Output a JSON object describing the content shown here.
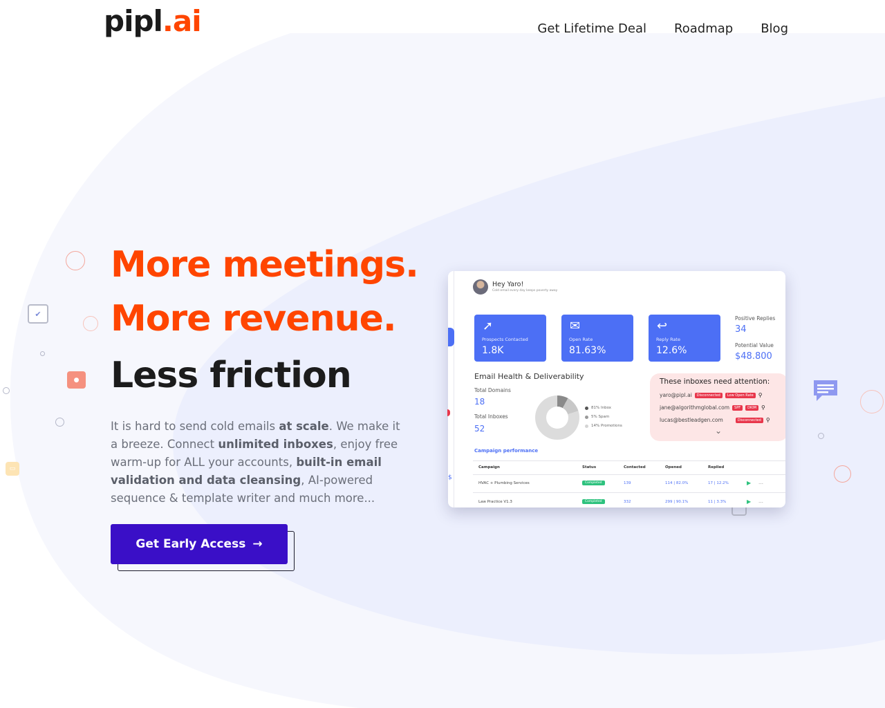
{
  "brand": {
    "logo_main": "pipl",
    "logo_accent": ".ai"
  },
  "nav": {
    "items": [
      "Get Lifetime Deal",
      "Roadmap",
      "Blog"
    ]
  },
  "hero": {
    "line1": "More meetings.",
    "line2": "More revenue.",
    "line3": "Less friction",
    "desc": [
      {
        "t": "It is hard to send cold emails ",
        "b": false
      },
      {
        "t": "at scale",
        "b": true
      },
      {
        "t": ". We make it a breeze. Connect ",
        "b": false
      },
      {
        "t": "unlimited inboxes",
        "b": true
      },
      {
        "t": ", enjoy free warm-up for ALL your accounts, ",
        "b": false
      },
      {
        "t": "built-in email validation and data cleansing",
        "b": true
      },
      {
        "t": ", AI-powered sequence & template writer and much more...",
        "b": false
      }
    ],
    "cta_label": "Get Early Access",
    "cta_arrow": "→"
  },
  "dashboard": {
    "greeting": "Hey Yaro!",
    "greeting_sub": "Cold email every day keeps poverty away",
    "stats": [
      {
        "icon": "paper-plane-icon",
        "glyph": "➚",
        "label": "Prospects Contacted",
        "value": "1.8K"
      },
      {
        "icon": "envelope-open-icon",
        "glyph": "✉",
        "label": "Open Rate",
        "value": "81.63%"
      },
      {
        "icon": "reply-icon",
        "glyph": "↩",
        "label": "Reply Rate",
        "value": "12.6%"
      }
    ],
    "side": {
      "positive_label": "Positive Replies",
      "positive_value": "34",
      "potential_label": "Potential Value",
      "potential_value": "$48.800"
    },
    "email_health": {
      "title": "Email Health & Deliverability",
      "domains_label": "Total Domains",
      "domains_value": "18",
      "inboxes_label": "Total Inboxes",
      "inboxes_value": "52",
      "legend": [
        {
          "label": "81% Inbox",
          "color": "#555555"
        },
        {
          "label": "5% Spam",
          "color": "#9a9a9a"
        },
        {
          "label": "14% Promotions",
          "color": "#d4d4d4"
        }
      ]
    },
    "attention": {
      "title": "These inboxes need attention:",
      "rows": [
        {
          "email": "yaro@pipl.ai",
          "tags": [
            "Disconnected",
            "Low Open Rate"
          ]
        },
        {
          "email": "jane@algorithmglobal.com",
          "tags": [
            "SPF",
            "DKIM"
          ]
        },
        {
          "email": "lucas@bestleadgen.com",
          "tags": [
            "Disconnected"
          ]
        }
      ]
    },
    "campaign": {
      "title": "Campaign performance",
      "headers": [
        "Campaign",
        "Status",
        "Contacted",
        "Opened",
        "Replied"
      ],
      "rows": [
        {
          "name": "HVAC + Plumbing Services",
          "status": "Completed",
          "contacted": "139",
          "opened": "114 | 82.0%",
          "replied": "17 | 12.2%"
        },
        {
          "name": "Law Practice V1.3",
          "status": "Completed",
          "contacted": "332",
          "opened": "299 | 90.1%",
          "replied": "11 | 3.3%"
        }
      ]
    }
  }
}
